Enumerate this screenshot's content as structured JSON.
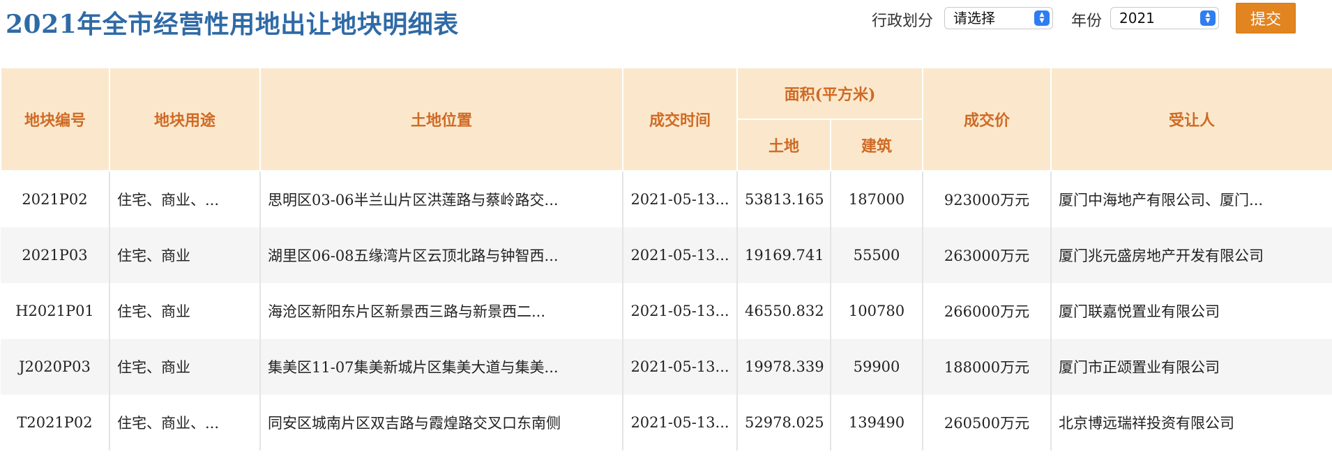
{
  "page": {
    "title": "2021年全市经营性用地出让地块明细表"
  },
  "filters": {
    "district_label": "行政划分",
    "district_value": "请选择",
    "year_label": "年份",
    "year_value": "2021",
    "submit_label": "提交"
  },
  "table": {
    "headers": {
      "plot_id": "地块编号",
      "use": "地块用途",
      "location": "土地位置",
      "deal_time": "成交时间",
      "area_group": "面积(平方米)",
      "area_land": "土地",
      "area_building": "建筑",
      "price": "成交价",
      "assignee": "受让人"
    },
    "rows": [
      [
        "2021P02",
        "住宅、商业、...",
        "思明区03-06半兰山片区洪莲路与蔡岭路交...",
        "2021-05-13...",
        "53813.165",
        "187000",
        "923000万元",
        "厦门中海地产有限公司、厦门..."
      ],
      [
        "2021P03",
        "住宅、商业",
        "湖里区06-08五缘湾片区云顶北路与钟智西...",
        "2021-05-13...",
        "19169.741",
        "55500",
        "263000万元",
        "厦门兆元盛房地产开发有限公司"
      ],
      [
        "H2021P01",
        "住宅、商业",
        "海沧区新阳东片区新景西三路与新景西二...",
        "2021-05-13...",
        "46550.832",
        "100780",
        "266000万元",
        "厦门联嘉悦置业有限公司"
      ],
      [
        "J2020P03",
        "住宅、商业",
        "集美区11-07集美新城片区集美大道与集美...",
        "2021-05-13...",
        "19978.339",
        "59900",
        "188000万元",
        "厦门市正颂置业有限公司"
      ],
      [
        "T2021P02",
        "住宅、商业、...",
        "同安区城南片区双吉路与霞煌路交叉口东南侧",
        "2021-05-13...",
        "52978.025",
        "139490",
        "260500万元",
        "北京博远瑞祥投资有限公司"
      ]
    ]
  }
}
